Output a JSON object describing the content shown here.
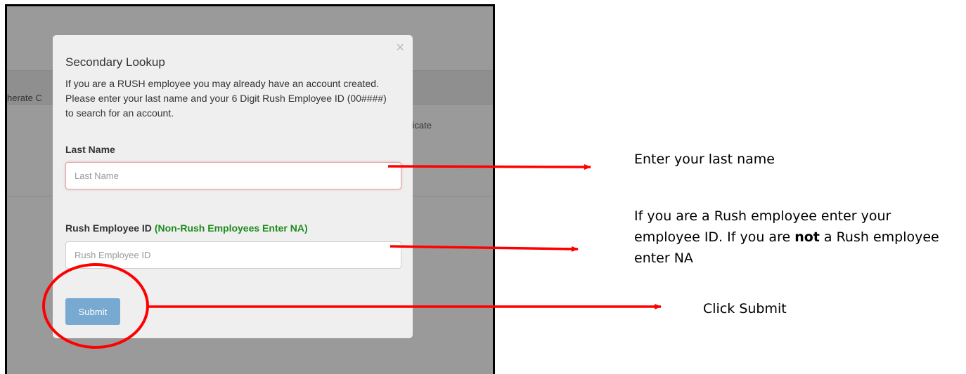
{
  "background": {
    "left_text": "herate C",
    "right_text": "ificate"
  },
  "modal": {
    "close_glyph": "×",
    "title": "Secondary Lookup",
    "description": "If you are a RUSH employee you may already have an account created. Please enter your last name and your 6 Digit Rush Employee ID (00####) to search for an account.",
    "last_name_label": "Last Name",
    "last_name_placeholder": "Last Name",
    "last_name_value": "",
    "employee_id_label": "Rush Employee ID",
    "employee_id_note": "(Non-Rush Employees Enter NA)",
    "employee_id_placeholder": "Rush Employee ID",
    "employee_id_value": "",
    "submit_label": "Submit"
  },
  "annotations": {
    "last_name_text": "Enter your last name",
    "employee_id_text_1": "If you are a Rush employee enter your employee ID.  If you are ",
    "employee_id_bold": "not",
    "employee_id_text_2": " a Rush employee enter NA",
    "submit_text": "Click Submit"
  },
  "colors": {
    "overlay": "#9a9a9a",
    "modal_bg": "#efefef",
    "submit_button": "#78a9d0",
    "note_green": "#1e8c1e",
    "annotation_red": "#ff0000"
  },
  "icons": {
    "close": "close-icon"
  }
}
